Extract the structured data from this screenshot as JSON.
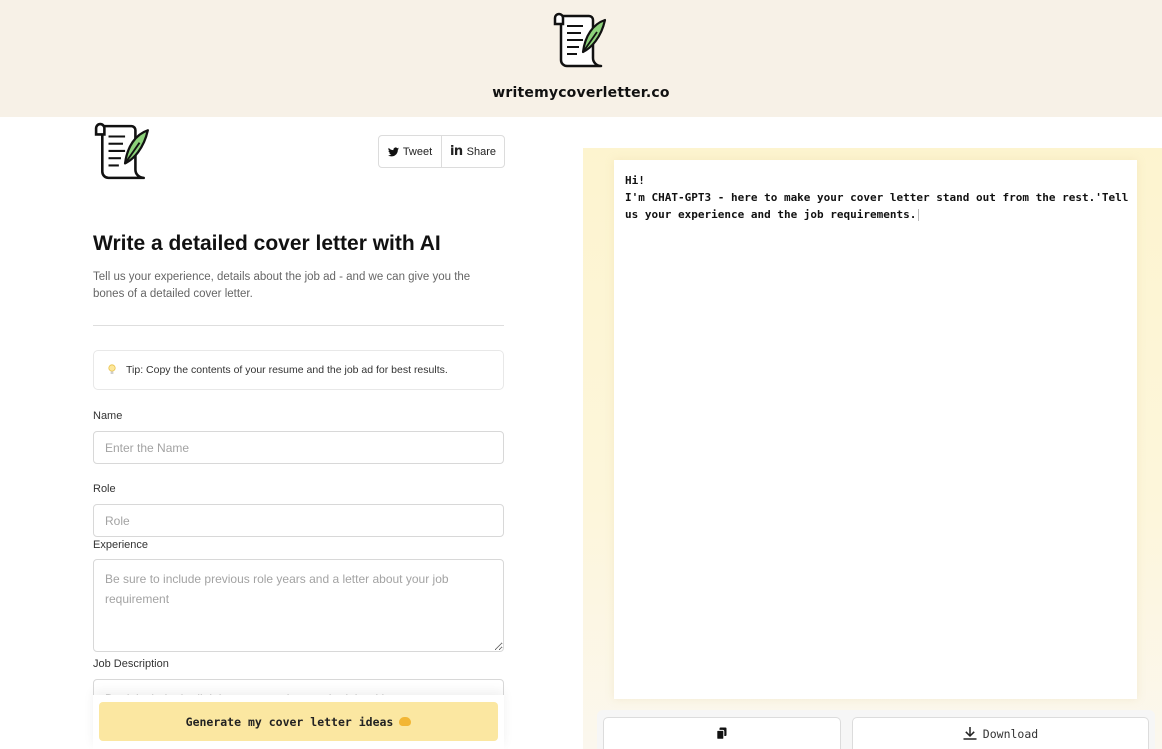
{
  "header": {
    "brand": "writemycoverletter.co"
  },
  "social": {
    "tweet_label": "Tweet",
    "share_label": "Share",
    "share_icon_text": "in"
  },
  "main": {
    "title": "Write a detailed cover letter with AI",
    "subtitle": "Tell us your experience, details about the job ad - and we can give you the bones of a detailed cover letter.",
    "tip": "Tip: Copy the contents of your resume and the job ad for best results."
  },
  "form": {
    "name": {
      "label": "Name",
      "placeholder": "Enter the Name",
      "value": ""
    },
    "role": {
      "label": "Role",
      "placeholder": "Role",
      "value": ""
    },
    "experience": {
      "label": "Experience",
      "placeholder": "Be sure to include previous role years and a letter about your job requirement",
      "value": ""
    },
    "job_description": {
      "label": "Job Description",
      "placeholder": "Don't include the link just copy and paste the job ad here",
      "value": ""
    },
    "generate_label": "Generate my cover letter ideas"
  },
  "output": {
    "text": "Hi!\nI'm CHAT-GPT3 - here to make your cover letter stand out from the rest.'Tell us your experience and the job requirements.",
    "download_label": "Download"
  },
  "colors": {
    "header_bg": "#f7f1e7",
    "accent_yellow": "#fbe7a1",
    "panel_bg": "#fdf4cf"
  },
  "icons": [
    "scroll-quill-logo",
    "twitter-icon",
    "linkedin-icon",
    "lightbulb-icon",
    "hand-emoji-icon",
    "copy-icon",
    "download-icon"
  ]
}
